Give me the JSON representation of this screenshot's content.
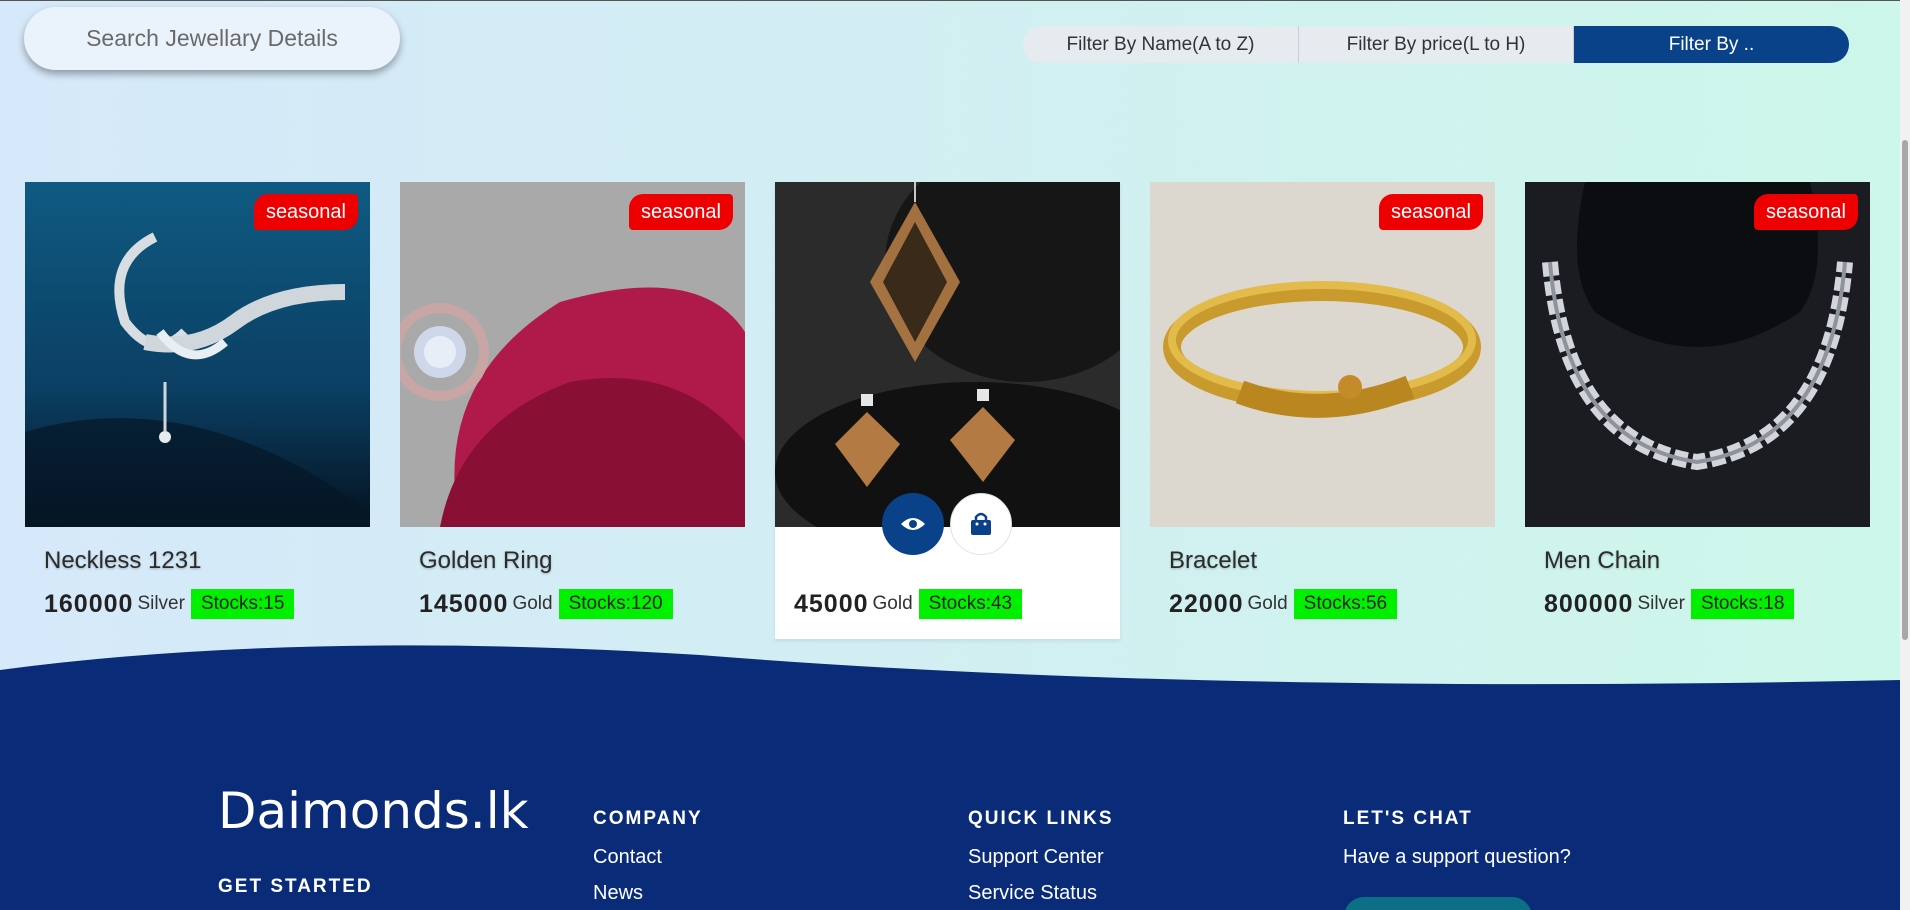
{
  "search": {
    "placeholder": "Search Jewellary Details"
  },
  "filters": [
    {
      "label": "Filter By Name(A to Z)"
    },
    {
      "label": "Filter By price(L to H)"
    },
    {
      "label": "Filter By .."
    }
  ],
  "products": [
    {
      "name": "Neckless 1231",
      "price": "160000",
      "metal": "Silver",
      "stock": "Stocks:15",
      "badge": "seasonal"
    },
    {
      "name": "Golden Ring",
      "price": "145000",
      "metal": "Gold",
      "stock": "Stocks:120",
      "badge": "seasonal"
    },
    {
      "name": "",
      "price": "45000",
      "metal": "Gold",
      "stock": "Stocks:43",
      "badge": ""
    },
    {
      "name": "Bracelet",
      "price": "22000",
      "metal": "Gold",
      "stock": "Stocks:56",
      "badge": "seasonal"
    },
    {
      "name": "Men Chain",
      "price": "800000",
      "metal": "Silver",
      "stock": "Stocks:18",
      "badge": "seasonal"
    }
  ],
  "footer": {
    "brand": "Daimonds.lk",
    "get_started": "GET STARTED",
    "company": {
      "title": "COMPANY",
      "links": [
        "Contact",
        "News"
      ]
    },
    "quick_links": {
      "title": "QUICK LINKS",
      "links": [
        "Support Center",
        "Service Status"
      ]
    },
    "chat": {
      "title": "LET'S CHAT",
      "text": "Have a support question?"
    }
  },
  "colors": {
    "accent": "#0a4289",
    "badge": "#ee0000",
    "stock": "#00f000",
    "footer": "#0a2c78"
  }
}
